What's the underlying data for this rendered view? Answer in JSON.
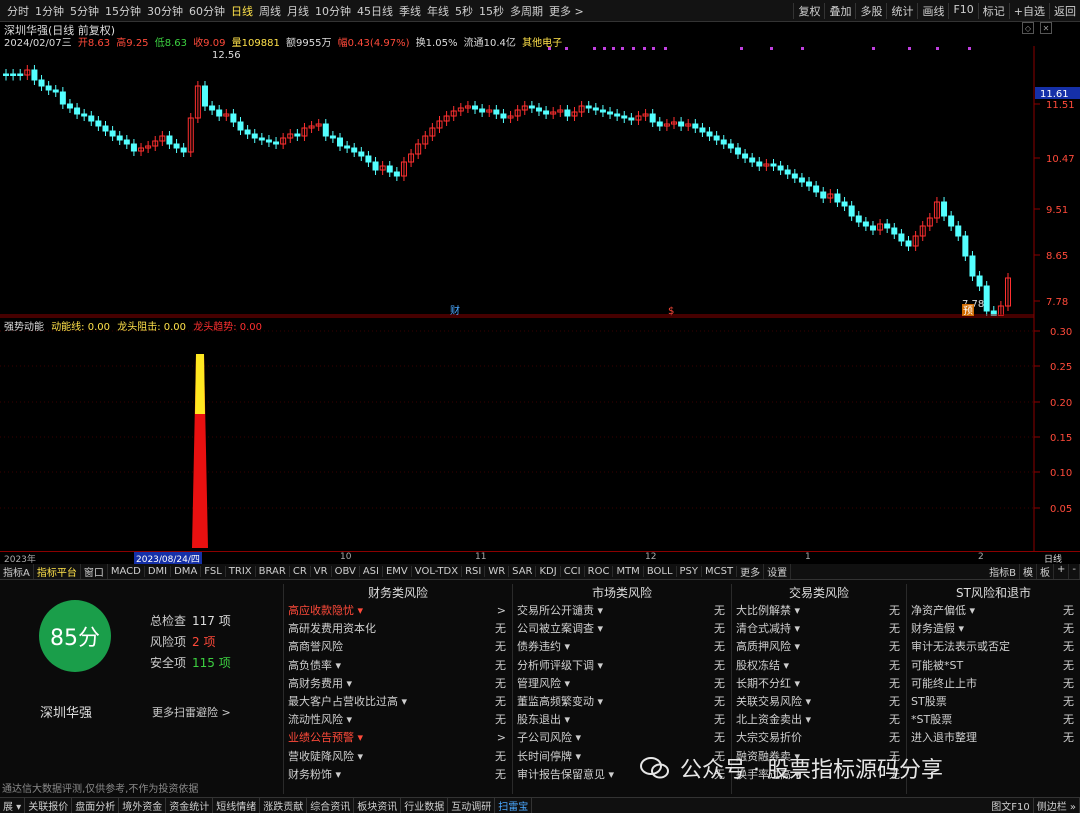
{
  "toolbar": {
    "periods": [
      "分时",
      "1分钟",
      "5分钟",
      "15分钟",
      "30分钟",
      "60分钟",
      "日线",
      "周线",
      "月线",
      "10分钟",
      "45日线",
      "季线",
      "年线",
      "5秒",
      "15秒",
      "多周期",
      "更多 >"
    ],
    "active_period": "日线",
    "right_buttons": [
      "复权",
      "叠加",
      "多股",
      "统计",
      "画线",
      "F10",
      "标记",
      "+自选",
      "返回"
    ]
  },
  "stock": {
    "header": "深圳华强(日线 前复权)",
    "date": "2024/02/07三",
    "open": "开8.63",
    "high": "高9.25",
    "low": "低8.63",
    "close": "收9.09",
    "volume": "量109881",
    "amount": "额9955万",
    "change": "幅0.43(4.97%)",
    "turnover": "换1.05%",
    "float_cap": "流通10.4亿",
    "sector": "其他电子"
  },
  "main_axis": {
    "labels": [
      "11.51",
      "10.47",
      "9.51",
      "8.65",
      "7.78"
    ],
    "current_price": "11.61",
    "max_label": "12.56",
    "min_label": "7.78"
  },
  "markers": [
    {
      "text": "财"
    },
    {
      "text": "$"
    },
    {
      "text": "预"
    }
  ],
  "indicator": {
    "name": "强势动能",
    "line1": "动能线: 0.00",
    "line2": "龙头阻击: 0.00",
    "line3": "龙头趋势: 0.00",
    "axis": [
      "0.30",
      "0.25",
      "0.20",
      "0.15",
      "0.10",
      "0.05"
    ]
  },
  "timeaxis": {
    "labels": [
      "2023年",
      "2023/08/24/四",
      "10",
      "11",
      "12",
      "1",
      "2"
    ],
    "right": "日线"
  },
  "tabs": {
    "items": [
      "指标A",
      "指标平台",
      "窗口",
      "MACD",
      "DMI",
      "DMA",
      "FSL",
      "TRIX",
      "BRAR",
      "CR",
      "VR",
      "OBV",
      "ASI",
      "EMV",
      "VOL-TDX",
      "RSI",
      "WR",
      "SAR",
      "KDJ",
      "CCI",
      "ROC",
      "MTM",
      "BOLL",
      "PSY",
      "MCST",
      "更多",
      "设置"
    ],
    "active": "指标平台",
    "right": [
      "指标B",
      "模",
      "板",
      "+",
      "-"
    ]
  },
  "scan": {
    "score": "85分",
    "name": "深圳华强",
    "total_label": "总检查",
    "total_value": "117 项",
    "risk_label": "风险项",
    "risk_value": "2 项",
    "safe_label": "安全项",
    "safe_value": "115 项",
    "more": "更多扫雷避险 >",
    "disclaimer": "通达信大数据评测,仅供参考,不作为投资依据"
  },
  "risk_columns": [
    {
      "title": "财务类风险",
      "items": [
        {
          "label": "高应收款隐忧 ▾",
          "value": ">",
          "red": true
        },
        {
          "label": "高研发费用资本化",
          "value": "无"
        },
        {
          "label": "高商誉风险",
          "value": "无"
        },
        {
          "label": "高负债率 ▾",
          "value": "无"
        },
        {
          "label": "高财务费用 ▾",
          "value": "无"
        },
        {
          "label": "最大客户占营收比过高 ▾",
          "value": "无"
        },
        {
          "label": "流动性风险 ▾",
          "value": "无"
        },
        {
          "label": "业绩公告预警 ▾",
          "value": ">",
          "red": true
        },
        {
          "label": "营收陡降风险 ▾",
          "value": "无"
        },
        {
          "label": "财务粉饰 ▾",
          "value": "无"
        }
      ]
    },
    {
      "title": "市场类风险",
      "items": [
        {
          "label": "交易所公开谴责 ▾",
          "value": "无"
        },
        {
          "label": "公司被立案调查 ▾",
          "value": "无"
        },
        {
          "label": "债券违约 ▾",
          "value": "无"
        },
        {
          "label": "分析师评级下调 ▾",
          "value": "无"
        },
        {
          "label": "管理风险 ▾",
          "value": "无"
        },
        {
          "label": "董监高频繁变动 ▾",
          "value": "无"
        },
        {
          "label": "股东退出 ▾",
          "value": "无"
        },
        {
          "label": "子公司风险 ▾",
          "value": "无"
        },
        {
          "label": "长时间停牌 ▾",
          "value": "无"
        },
        {
          "label": "审计报告保留意见 ▾",
          "value": "无"
        }
      ]
    },
    {
      "title": "交易类风险",
      "items": [
        {
          "label": "大比例解禁 ▾",
          "value": "无"
        },
        {
          "label": "清仓式减持 ▾",
          "value": "无"
        },
        {
          "label": "高质押风险 ▾",
          "value": "无"
        },
        {
          "label": "股权冻结 ▾",
          "value": "无"
        },
        {
          "label": "长期不分红 ▾",
          "value": "无"
        },
        {
          "label": "关联交易风险 ▾",
          "value": "无"
        },
        {
          "label": "北上资金卖出 ▾",
          "value": "无"
        },
        {
          "label": "大宗交易折价",
          "value": "无"
        },
        {
          "label": "融资融券卖 ▾",
          "value": "无"
        },
        {
          "label": "换手率过高 ▾",
          "value": "无"
        }
      ]
    },
    {
      "title": "ST风险和退市",
      "items": [
        {
          "label": "净资产偏低 ▾",
          "value": "无"
        },
        {
          "label": "财务造假 ▾",
          "value": "无"
        },
        {
          "label": "审计无法表示或否定",
          "value": "无"
        },
        {
          "label": "可能被*ST",
          "value": "无"
        },
        {
          "label": "可能终止上市",
          "value": "无"
        },
        {
          "label": "ST股票",
          "value": "无"
        },
        {
          "label": "*ST股票",
          "value": "无"
        },
        {
          "label": "进入退市整理",
          "value": "无"
        }
      ]
    }
  ],
  "footer": {
    "items": [
      "展 ▾",
      "关联报价",
      "盘面分析",
      "境外资金",
      "资金统计",
      "短线情绪",
      "涨跌贡献",
      "综合资讯",
      "板块资讯",
      "行业数据",
      "互动调研",
      "扫雷宝"
    ],
    "highlight": "扫雷宝",
    "right": [
      "图文F10",
      "侧边栏 »"
    ]
  },
  "watermark": "公众号 · 股票指标源码分享",
  "colors": {
    "up": "#ff3030",
    "down": "#54ffff",
    "accent": "#ffe24a",
    "green": "#1a9e4a"
  }
}
